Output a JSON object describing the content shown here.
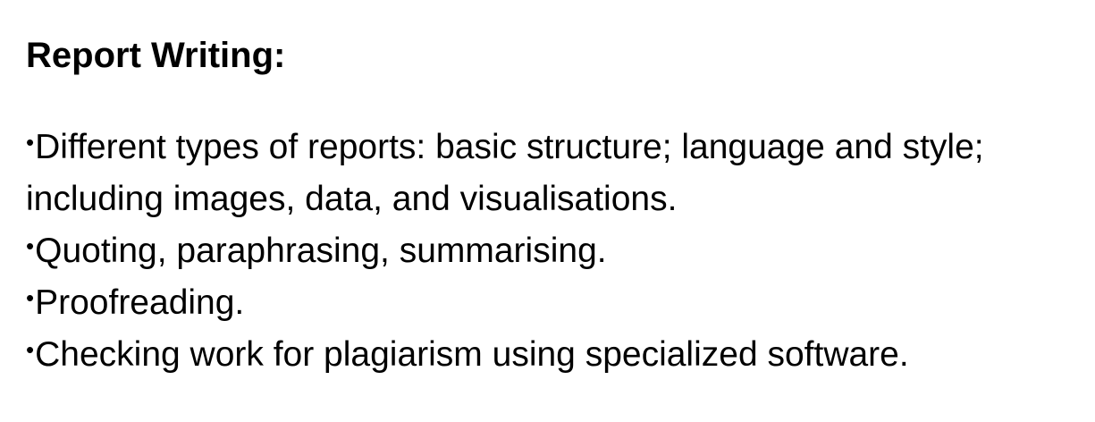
{
  "slide": {
    "title": "Report Writing:",
    "bullet_symbol": "•",
    "bullets": [
      {
        "text": "Different types of reports: basic structure; language and style; including images, data, and visualisations."
      },
      {
        "text": "Quoting, paraphrasing, summarising."
      },
      {
        "text": "Proofreading."
      },
      {
        "text": "Checking work for plagiarism using specialized software."
      }
    ]
  }
}
